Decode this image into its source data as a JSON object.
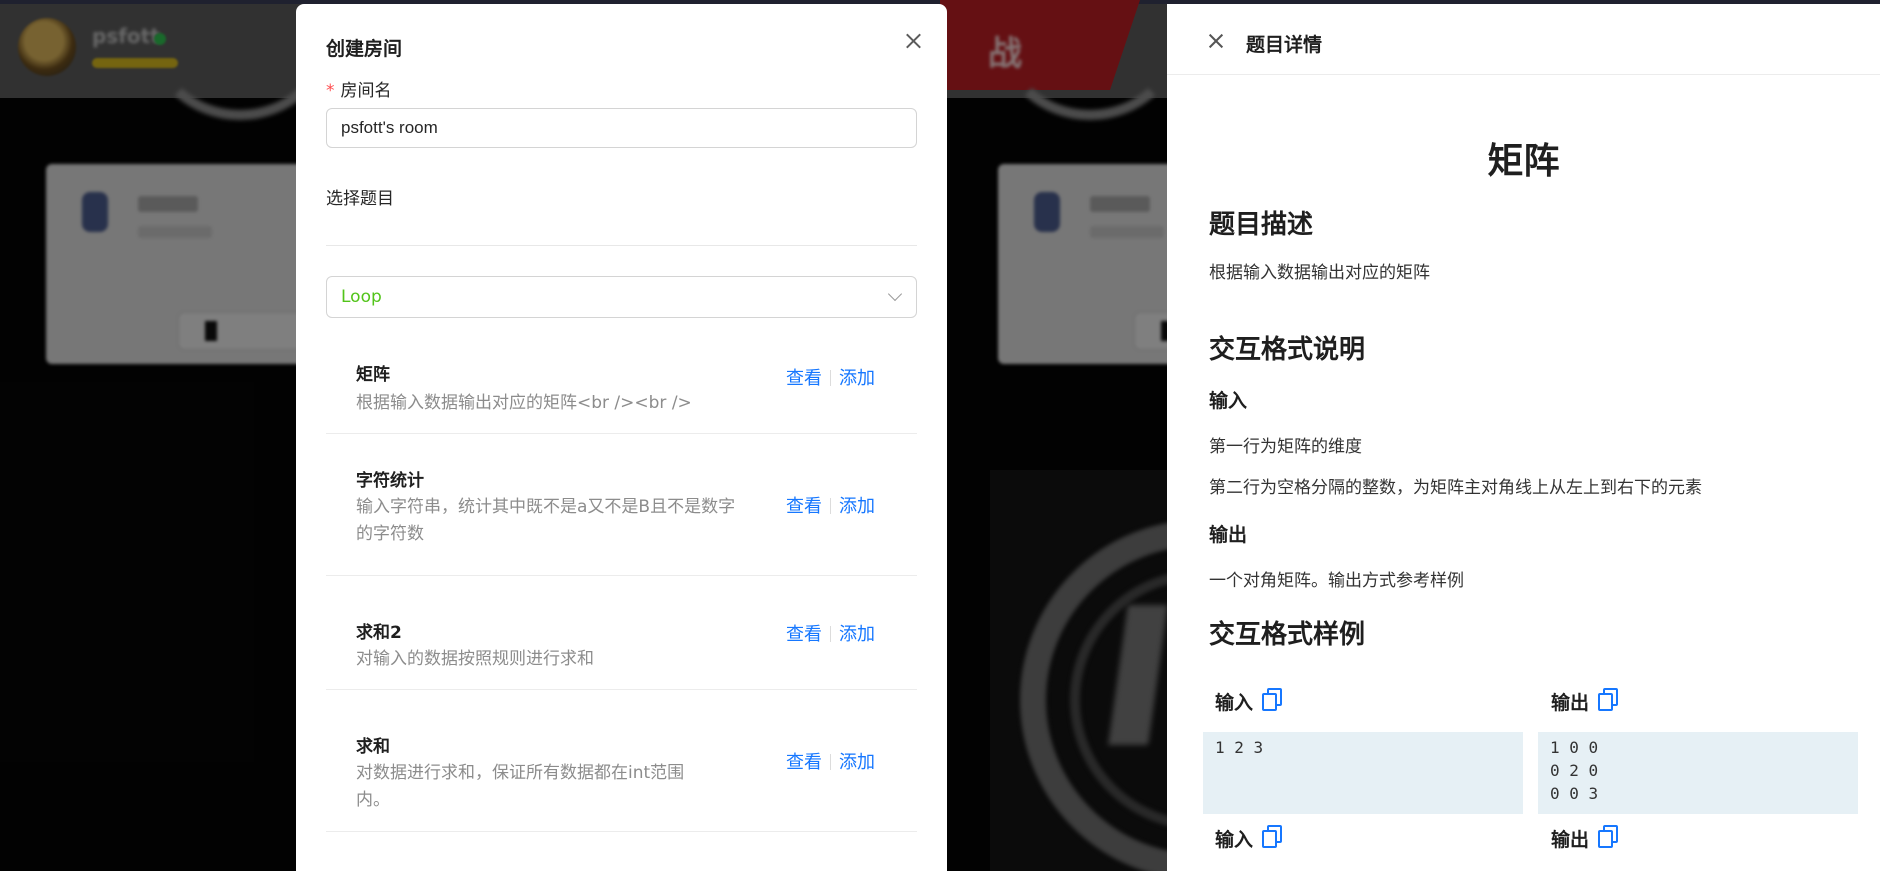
{
  "background_app": {
    "username": "psfott",
    "battle_label": "战"
  },
  "modal": {
    "title": "创建房间",
    "room_name_label": "房间名",
    "room_name_required_mark": "*",
    "room_name_value": "psfott's room",
    "select_problem_label": "选择题目",
    "category_value": "Loop",
    "view_label": "查看",
    "add_label": "添加",
    "problems": [
      {
        "name": "矩阵",
        "desc": "根据输入数据输出对应的矩阵<br /><br />"
      },
      {
        "name": "字符统计",
        "desc": "输入字符串，统计其中既不是a又不是B且不是数字的字符数"
      },
      {
        "name": "求和2",
        "desc": "对输入的数据按照规则进行求和"
      },
      {
        "name": "求和",
        "desc": "对数据进行求和，保证所有数据都在int范围内。"
      }
    ]
  },
  "drawer": {
    "header_title": "题目详情",
    "problem_title": "矩阵",
    "description_heading": "题目描述",
    "description_text": "根据输入数据输出对应的矩阵",
    "format_heading": "交互格式说明",
    "input_heading": "输入",
    "input_line1": "第一行为矩阵的维度",
    "input_line2": "第二行为空格分隔的整数，为矩阵主对角线上从左上到右下的元素",
    "output_heading": "输出",
    "output_text": "一个对角矩阵。输出方式参考样例",
    "samples_heading": "交互格式样例",
    "sample_input_label": "输入",
    "sample_output_label": "输出",
    "sample1_input": "1 2 3",
    "sample1_output": "1 0 0\n0 2 0\n0 0 3",
    "sample2_input_label": "输入",
    "sample2_output_label": "输出"
  },
  "colors": {
    "link": "#1677ff",
    "success_green": "#52c41a",
    "required_red": "#ff4d4f",
    "sample_bg": "#e6f0f5"
  },
  "icons": {
    "modal_close": "close-icon",
    "drawer_close": "close-icon",
    "select_arrow": "chevron-down-icon",
    "copy": "copy-icon"
  }
}
